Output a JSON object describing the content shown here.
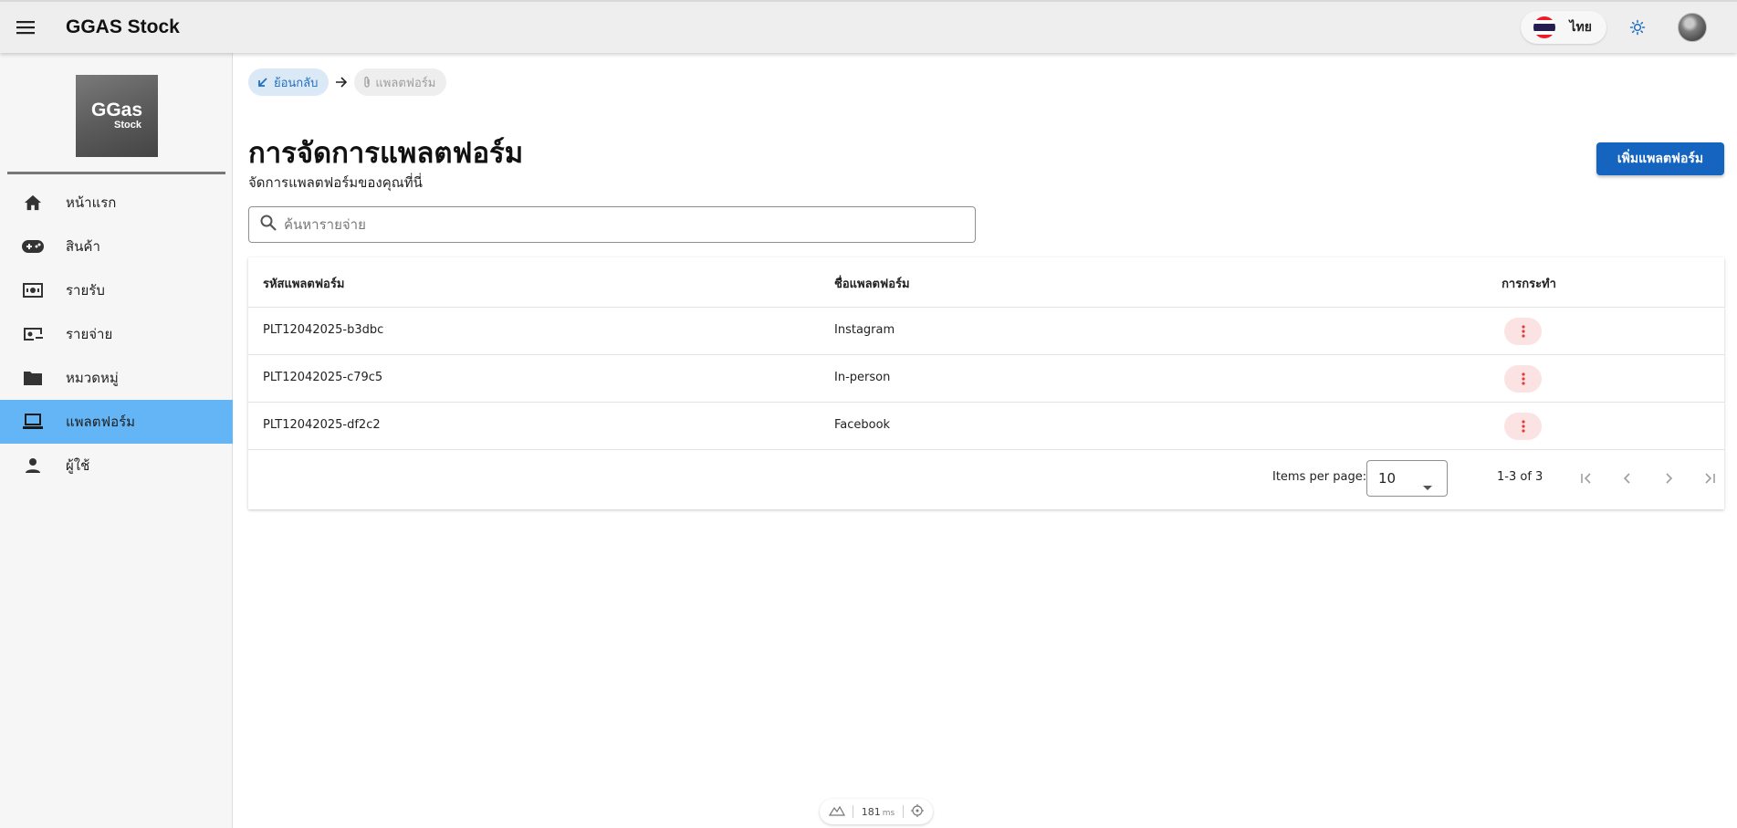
{
  "app": {
    "title": "GGAS Stock"
  },
  "header": {
    "language": "ไทย",
    "flag_colors": [
      "#ed1c24",
      "#ffffff",
      "#241d4f",
      "#ffffff",
      "#ed1c24"
    ]
  },
  "logo": {
    "line1": "GGas",
    "line2": "Stock"
  },
  "sidebar": {
    "items": [
      {
        "label": "หน้าแรก",
        "icon": "home-icon",
        "active": false
      },
      {
        "label": "สินค้า",
        "icon": "gamepad-icon",
        "active": false
      },
      {
        "label": "รายรับ",
        "icon": "money-icon",
        "active": false
      },
      {
        "label": "รายจ่าย",
        "icon": "money-off-icon",
        "active": false
      },
      {
        "label": "หมวดหมู่",
        "icon": "folder-icon",
        "active": false
      },
      {
        "label": "แพลตฟอร์ม",
        "icon": "laptop-icon",
        "active": true
      },
      {
        "label": "ผู้ใช้",
        "icon": "person-icon",
        "active": false
      }
    ]
  },
  "breadcrumb": {
    "back_label": "ย้อนกลับ",
    "current_label": "แพลตฟอร์ม"
  },
  "page": {
    "title": "การจัดการแพลตฟอร์ม",
    "subtitle": "จัดการแพลตฟอร์มของคุณที่นี่",
    "add_button": "เพิ่มแพลตฟอร์ม"
  },
  "search": {
    "placeholder": "ค้นหารายจ่าย",
    "value": ""
  },
  "table": {
    "columns": [
      "รหัสแพลตฟอร์ม",
      "ชื่อแพลตฟอร์ม",
      "การกระทำ"
    ],
    "rows": [
      {
        "id": "PLT12042025-b3dbc",
        "name": "Instagram"
      },
      {
        "id": "PLT12042025-c79c5",
        "name": "In-person"
      },
      {
        "id": "PLT12042025-df2c2",
        "name": "Facebook"
      }
    ]
  },
  "paginator": {
    "items_per_page_label": "Items per page:",
    "page_size": "10",
    "range_label": "1-3 of 3"
  },
  "perf": {
    "value": "181",
    "unit": "ms"
  },
  "colors": {
    "primary": "#1565c0",
    "active_nav": "#64b5f6",
    "action_bg": "#fbe3e3",
    "action_icon": "#e53935"
  }
}
